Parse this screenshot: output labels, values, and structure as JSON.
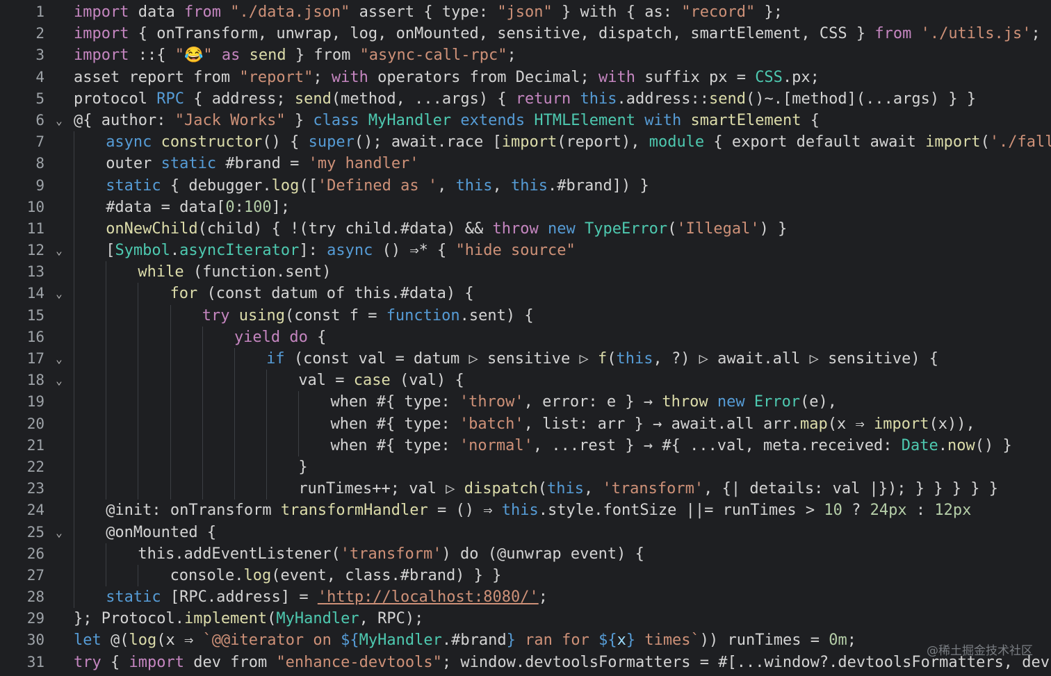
{
  "colors": {
    "background": "#1e1f22",
    "default": "#d4d4d4",
    "keyword": "#c586c0",
    "keyword2": "#569cd6",
    "string": "#ce9178",
    "function": "#dcdcaa",
    "type": "#4ec9b0",
    "number": "#b5cea8",
    "variable": "#9cdcfe",
    "lineNumber": "#9ea3a8",
    "link": "#ce9178"
  },
  "lines": [
    {
      "n": "1",
      "fold": "",
      "indent": 0,
      "tokens": [
        [
          "import",
          "keyword"
        ],
        [
          " data ",
          "default"
        ],
        [
          "from",
          "keyword"
        ],
        [
          " ",
          "default"
        ],
        [
          "\"./data.json\"",
          "string"
        ],
        [
          " assert { type: ",
          "default"
        ],
        [
          "\"json\"",
          "string"
        ],
        [
          " } with { as: ",
          "default"
        ],
        [
          "\"record\"",
          "string"
        ],
        [
          " };",
          "default"
        ]
      ]
    },
    {
      "n": "2",
      "fold": "",
      "indent": 0,
      "tokens": [
        [
          "import",
          "keyword"
        ],
        [
          " { onTransform, unwrap, log, onMounted, sensitive, dispatch, smartElement, CSS } ",
          "default"
        ],
        [
          "from",
          "keyword"
        ],
        [
          " ",
          "default"
        ],
        [
          "'./utils.js'",
          "string"
        ],
        [
          ";",
          "default"
        ]
      ]
    },
    {
      "n": "3",
      "fold": "",
      "indent": 0,
      "tokens": [
        [
          "import",
          "keyword"
        ],
        [
          " ::{ ",
          "default"
        ],
        [
          "\"😂\"",
          "string"
        ],
        [
          " ",
          "default"
        ],
        [
          "as",
          "keyword"
        ],
        [
          " ",
          "default"
        ],
        [
          "send",
          "function"
        ],
        [
          " } from ",
          "default"
        ],
        [
          "\"async-call-rpc\"",
          "string"
        ],
        [
          ";",
          "default"
        ]
      ]
    },
    {
      "n": "4",
      "fold": "",
      "indent": 0,
      "tokens": [
        [
          "asset report from ",
          "default"
        ],
        [
          "\"report\"",
          "string"
        ],
        [
          "; ",
          "default"
        ],
        [
          "with",
          "keyword"
        ],
        [
          " operators from Decimal; ",
          "default"
        ],
        [
          "with",
          "keyword"
        ],
        [
          " suffix px = ",
          "default"
        ],
        [
          "CSS",
          "type"
        ],
        [
          ".px;",
          "default"
        ]
      ]
    },
    {
      "n": "5",
      "fold": "",
      "indent": 0,
      "tokens": [
        [
          "protocol ",
          "default"
        ],
        [
          "RPC",
          "keyword2"
        ],
        [
          " { address; ",
          "default"
        ],
        [
          "send",
          "function"
        ],
        [
          "(method, ...args) { ",
          "default"
        ],
        [
          "return",
          "keyword"
        ],
        [
          " ",
          "default"
        ],
        [
          "this",
          "keyword2"
        ],
        [
          ".address::",
          "default"
        ],
        [
          "send",
          "function"
        ],
        [
          "()~.[method](...args) } }",
          "default"
        ]
      ]
    },
    {
      "n": "6",
      "fold": "⌄",
      "indent": 0,
      "tokens": [
        [
          "@{ author: ",
          "default"
        ],
        [
          "\"Jack Works\"",
          "string"
        ],
        [
          " } ",
          "default"
        ],
        [
          "class",
          "keyword2"
        ],
        [
          " ",
          "default"
        ],
        [
          "MyHandler",
          "type"
        ],
        [
          " ",
          "default"
        ],
        [
          "extends",
          "keyword2"
        ],
        [
          " ",
          "default"
        ],
        [
          "HTMLElement",
          "type"
        ],
        [
          " ",
          "default"
        ],
        [
          "with",
          "keyword2"
        ],
        [
          " ",
          "default"
        ],
        [
          "smartElement",
          "function"
        ],
        [
          " {",
          "default"
        ]
      ]
    },
    {
      "n": "7",
      "fold": "",
      "indent": 1,
      "tokens": [
        [
          "async",
          "keyword2"
        ],
        [
          " ",
          "default"
        ],
        [
          "constructor",
          "function"
        ],
        [
          "() { ",
          "default"
        ],
        [
          "super",
          "keyword2"
        ],
        [
          "(); await.race [",
          "default"
        ],
        [
          "import",
          "function"
        ],
        [
          "(report), ",
          "default"
        ],
        [
          "module",
          "type"
        ],
        [
          " { export default await ",
          "default"
        ],
        [
          "import",
          "function"
        ],
        [
          "(",
          "default"
        ],
        [
          "'./fallback.js'",
          "string"
        ],
        [
          ") }] }",
          "default"
        ]
      ]
    },
    {
      "n": "8",
      "fold": "",
      "indent": 1,
      "tokens": [
        [
          "outer ",
          "default"
        ],
        [
          "static",
          "keyword2"
        ],
        [
          " #brand = ",
          "default"
        ],
        [
          "'my handler'",
          "string"
        ]
      ]
    },
    {
      "n": "9",
      "fold": "",
      "indent": 1,
      "tokens": [
        [
          "static",
          "keyword2"
        ],
        [
          " { debugger.",
          "default"
        ],
        [
          "log",
          "function"
        ],
        [
          "([",
          "default"
        ],
        [
          "'Defined as '",
          "string"
        ],
        [
          ", ",
          "default"
        ],
        [
          "this",
          "keyword2"
        ],
        [
          ", ",
          "default"
        ],
        [
          "this",
          "keyword2"
        ],
        [
          ".#brand]) }",
          "default"
        ]
      ]
    },
    {
      "n": "10",
      "fold": "",
      "indent": 1,
      "tokens": [
        [
          "#data = data[",
          "default"
        ],
        [
          "0",
          "number"
        ],
        [
          ":",
          "default"
        ],
        [
          "100",
          "number"
        ],
        [
          "];",
          "default"
        ]
      ]
    },
    {
      "n": "11",
      "fold": "",
      "indent": 1,
      "tokens": [
        [
          "onNewChild",
          "function"
        ],
        [
          "(child) { !(try child.#data) && ",
          "default"
        ],
        [
          "throw",
          "keyword"
        ],
        [
          " ",
          "default"
        ],
        [
          "new",
          "keyword2"
        ],
        [
          " ",
          "default"
        ],
        [
          "TypeError",
          "type"
        ],
        [
          "(",
          "default"
        ],
        [
          "'Illegal'",
          "string"
        ],
        [
          ") }",
          "default"
        ]
      ]
    },
    {
      "n": "12",
      "fold": "⌄",
      "indent": 1,
      "tokens": [
        [
          "[",
          "default"
        ],
        [
          "Symbol",
          "type"
        ],
        [
          ".",
          "default"
        ],
        [
          "asyncIterator",
          "type"
        ],
        [
          "]: ",
          "default"
        ],
        [
          "async",
          "keyword2"
        ],
        [
          " () ⇒* { ",
          "default"
        ],
        [
          "\"hide source\"",
          "string"
        ]
      ]
    },
    {
      "n": "13",
      "fold": "",
      "indent": 2,
      "tokens": [
        [
          "while",
          "function"
        ],
        [
          " (function.sent)",
          "default"
        ]
      ]
    },
    {
      "n": "14",
      "fold": "⌄",
      "indent": 3,
      "tokens": [
        [
          "for",
          "function"
        ],
        [
          " (const datum of this.#data) {",
          "default"
        ]
      ]
    },
    {
      "n": "15",
      "fold": "",
      "indent": 4,
      "tokens": [
        [
          "try",
          "keyword"
        ],
        [
          " ",
          "default"
        ],
        [
          "using",
          "function"
        ],
        [
          "(const f = ",
          "default"
        ],
        [
          "function",
          "keyword2"
        ],
        [
          ".sent) {",
          "default"
        ]
      ]
    },
    {
      "n": "16",
      "fold": "",
      "indent": 5,
      "tokens": [
        [
          "yield",
          "keyword"
        ],
        [
          " ",
          "default"
        ],
        [
          "do",
          "keyword"
        ],
        [
          " {",
          "default"
        ]
      ]
    },
    {
      "n": "17",
      "fold": "⌄",
      "indent": 6,
      "tokens": [
        [
          "if",
          "keyword2"
        ],
        [
          " (const val = datum ▷ sensitive ▷ ",
          "default"
        ],
        [
          "f",
          "function"
        ],
        [
          "(",
          "default"
        ],
        [
          "this",
          "keyword2"
        ],
        [
          ", ?) ▷ await.all ▷ sensitive) {",
          "default"
        ]
      ]
    },
    {
      "n": "18",
      "fold": "⌄",
      "indent": 7,
      "tokens": [
        [
          "val = ",
          "default"
        ],
        [
          "case",
          "function"
        ],
        [
          " (val) {",
          "default"
        ]
      ]
    },
    {
      "n": "19",
      "fold": "",
      "indent": 8,
      "tokens": [
        [
          "when #{ type: ",
          "default"
        ],
        [
          "'throw'",
          "string"
        ],
        [
          ", error: e } → ",
          "default"
        ],
        [
          "throw",
          "function"
        ],
        [
          " ",
          "default"
        ],
        [
          "new",
          "keyword2"
        ],
        [
          " ",
          "default"
        ],
        [
          "Error",
          "type"
        ],
        [
          "(e),",
          "default"
        ]
      ]
    },
    {
      "n": "20",
      "fold": "",
      "indent": 8,
      "tokens": [
        [
          "when #{ type: ",
          "default"
        ],
        [
          "'batch'",
          "string"
        ],
        [
          ", list: arr } → await.all arr.",
          "default"
        ],
        [
          "map",
          "function"
        ],
        [
          "(x ⇒ ",
          "default"
        ],
        [
          "import",
          "function"
        ],
        [
          "(x)),",
          "default"
        ]
      ]
    },
    {
      "n": "21",
      "fold": "",
      "indent": 8,
      "tokens": [
        [
          "when #{ type: ",
          "default"
        ],
        [
          "'normal'",
          "string"
        ],
        [
          ", ...rest } → #{ ...val, meta.received: ",
          "default"
        ],
        [
          "Date",
          "type"
        ],
        [
          ".",
          "default"
        ],
        [
          "now",
          "function"
        ],
        [
          "() }",
          "default"
        ]
      ]
    },
    {
      "n": "22",
      "fold": "",
      "indent": 7,
      "tokens": [
        [
          "}",
          "default"
        ]
      ]
    },
    {
      "n": "23",
      "fold": "",
      "indent": 7,
      "tokens": [
        [
          "runTimes++; val ▷ ",
          "default"
        ],
        [
          "dispatch",
          "function"
        ],
        [
          "(",
          "default"
        ],
        [
          "this",
          "keyword2"
        ],
        [
          ", ",
          "default"
        ],
        [
          "'transform'",
          "string"
        ],
        [
          ", {| details: val |}); } } } } }",
          "default"
        ]
      ]
    },
    {
      "n": "24",
      "fold": "",
      "indent": 1,
      "tokens": [
        [
          "@init: onTransform ",
          "default"
        ],
        [
          "transformHandler",
          "function"
        ],
        [
          " = () ⇒ ",
          "default"
        ],
        [
          "this",
          "keyword2"
        ],
        [
          ".style.fontSize ||= runTimes > ",
          "default"
        ],
        [
          "10",
          "number"
        ],
        [
          " ? ",
          "default"
        ],
        [
          "24px",
          "number"
        ],
        [
          " : ",
          "default"
        ],
        [
          "12px",
          "number"
        ]
      ]
    },
    {
      "n": "25",
      "fold": "⌄",
      "indent": 1,
      "tokens": [
        [
          "@onMounted {",
          "default"
        ]
      ]
    },
    {
      "n": "26",
      "fold": "",
      "indent": 2,
      "tokens": [
        [
          "this.addEventListener(",
          "default"
        ],
        [
          "'transform'",
          "string"
        ],
        [
          ") do (@unwrap event) {",
          "default"
        ]
      ]
    },
    {
      "n": "27",
      "fold": "",
      "indent": 3,
      "tokens": [
        [
          "console.",
          "default"
        ],
        [
          "log",
          "function"
        ],
        [
          "(event, class.#brand) } }",
          "default"
        ]
      ]
    },
    {
      "n": "28",
      "fold": "",
      "indent": 1,
      "tokens": [
        [
          "static",
          "keyword2"
        ],
        [
          " [RPC.address] = ",
          "default"
        ],
        [
          "'http://localhost:8080/'",
          "link"
        ],
        [
          ";",
          "default"
        ]
      ]
    },
    {
      "n": "29",
      "fold": "",
      "indent": 0,
      "tokens": [
        [
          "}; Protocol.",
          "default"
        ],
        [
          "implement",
          "function"
        ],
        [
          "(",
          "default"
        ],
        [
          "MyHandler",
          "type"
        ],
        [
          ", RPC);",
          "default"
        ]
      ]
    },
    {
      "n": "30",
      "fold": "",
      "indent": 0,
      "tokens": [
        [
          "let",
          "keyword2"
        ],
        [
          " @(",
          "default"
        ],
        [
          "log",
          "function"
        ],
        [
          "(x ⇒ ",
          "default"
        ],
        [
          "`@@iterator on ",
          "string"
        ],
        [
          "${",
          "keyword2"
        ],
        [
          "MyHandler",
          "type"
        ],
        [
          ".#brand",
          "default"
        ],
        [
          "}",
          "keyword2"
        ],
        [
          " ran for ",
          "string"
        ],
        [
          "${",
          "keyword2"
        ],
        [
          "x",
          "variable"
        ],
        [
          "}",
          "keyword2"
        ],
        [
          " times`",
          "string"
        ],
        [
          ")) runTimes = ",
          "default"
        ],
        [
          "0m",
          "number"
        ],
        [
          ";",
          "default"
        ]
      ]
    },
    {
      "n": "31",
      "fold": "",
      "indent": 0,
      "tokens": [
        [
          "try",
          "keyword"
        ],
        [
          " { ",
          "default"
        ],
        [
          "import",
          "keyword"
        ],
        [
          " dev from ",
          "default"
        ],
        [
          "\"enhance-devtools\"",
          "string"
        ],
        [
          "; window.devtoolsFormatters = #[...window?.devtoolsFormatters, dev]; } catch {}",
          "default"
        ]
      ]
    }
  ],
  "watermark": "@稀土掘金技术社区"
}
